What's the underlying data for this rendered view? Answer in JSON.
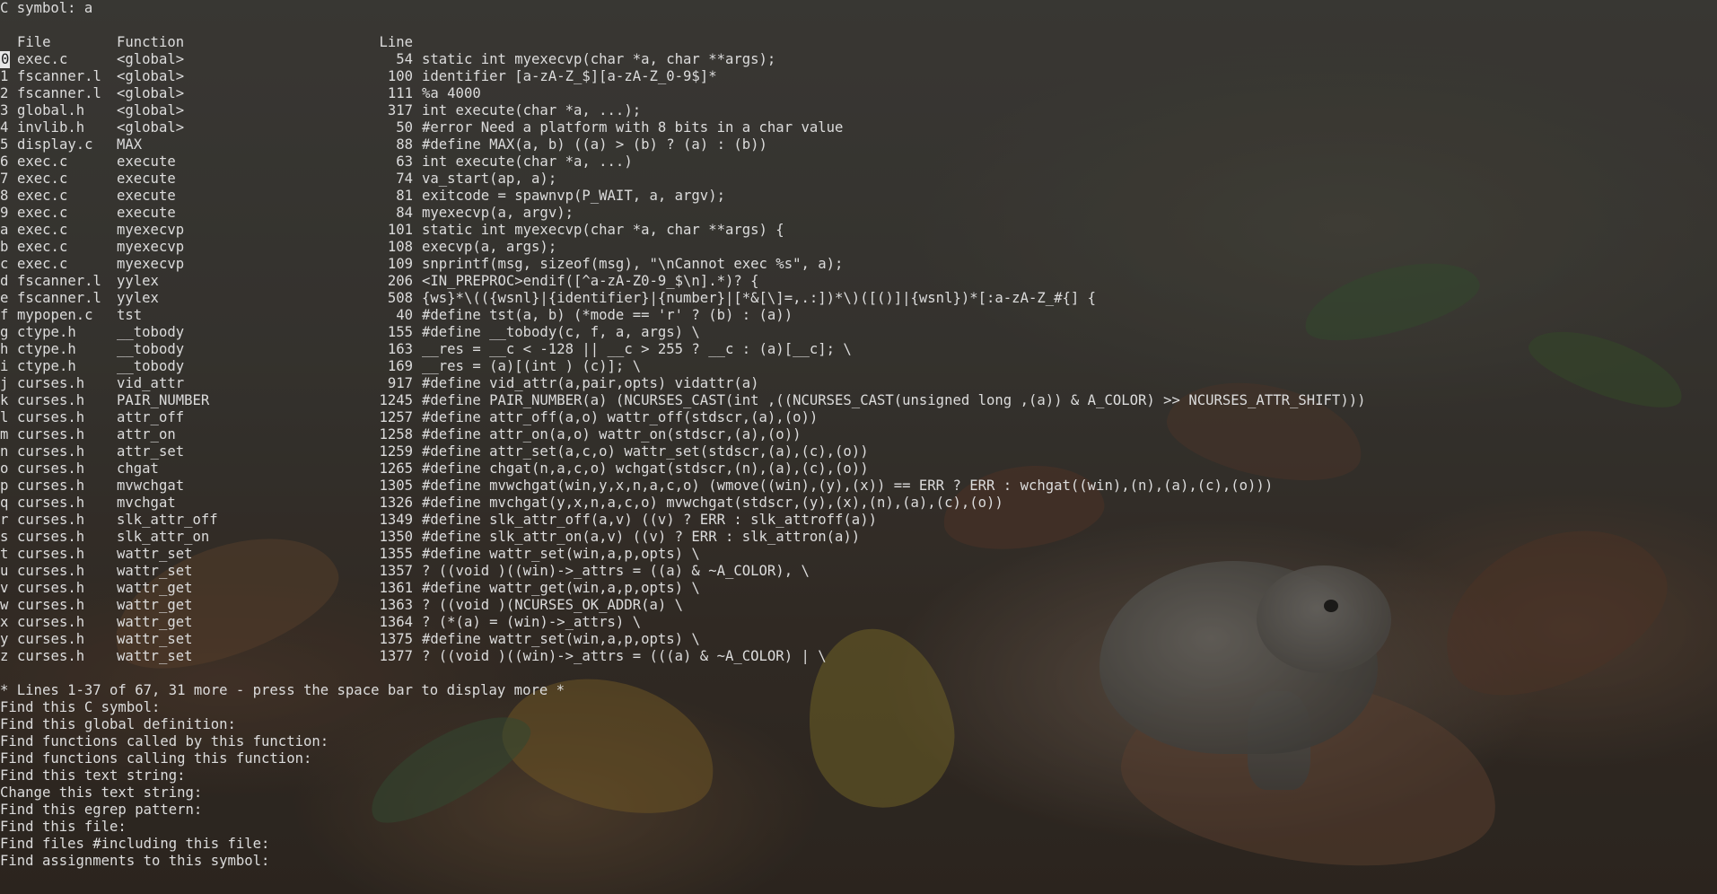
{
  "header": {
    "title": "C symbol: a"
  },
  "columns": {
    "file": "File",
    "function": "Function",
    "line": "Line"
  },
  "results": [
    {
      "key": "0",
      "file": "exec.c",
      "function": "<global>",
      "line": "54",
      "text": "static int myexecvp(char *a, char **args);"
    },
    {
      "key": "1",
      "file": "fscanner.l",
      "function": "<global>",
      "line": "100",
      "text": "identifier [a-zA-Z_$][a-zA-Z_0-9$]*"
    },
    {
      "key": "2",
      "file": "fscanner.l",
      "function": "<global>",
      "line": "111",
      "text": "%a 4000"
    },
    {
      "key": "3",
      "file": "global.h",
      "function": "<global>",
      "line": "317",
      "text": "int execute(char *a, ...);"
    },
    {
      "key": "4",
      "file": "invlib.h",
      "function": "<global>",
      "line": "50",
      "text": "#error Need a platform with 8 bits in a char value"
    },
    {
      "key": "5",
      "file": "display.c",
      "function": "MAX",
      "line": "88",
      "text": "#define MAX(a, b) ((a) > (b) ? (a) : (b))"
    },
    {
      "key": "6",
      "file": "exec.c",
      "function": "execute",
      "line": "63",
      "text": "int execute(char *a, ...)"
    },
    {
      "key": "7",
      "file": "exec.c",
      "function": "execute",
      "line": "74",
      "text": "va_start(ap, a);"
    },
    {
      "key": "8",
      "file": "exec.c",
      "function": "execute",
      "line": "81",
      "text": "exitcode = spawnvp(P_WAIT, a, argv);"
    },
    {
      "key": "9",
      "file": "exec.c",
      "function": "execute",
      "line": "84",
      "text": "myexecvp(a, argv);"
    },
    {
      "key": "a",
      "file": "exec.c",
      "function": "myexecvp",
      "line": "101",
      "text": "static int myexecvp(char *a, char **args) {"
    },
    {
      "key": "b",
      "file": "exec.c",
      "function": "myexecvp",
      "line": "108",
      "text": "execvp(a, args);"
    },
    {
      "key": "c",
      "file": "exec.c",
      "function": "myexecvp",
      "line": "109",
      "text": "snprintf(msg, sizeof(msg), \"\\nCannot exec %s\", a);"
    },
    {
      "key": "d",
      "file": "fscanner.l",
      "function": "yylex",
      "line": "206",
      "text": "<IN_PREPROC>endif([^a-zA-Z0-9_$\\n].*)? {"
    },
    {
      "key": "e",
      "file": "fscanner.l",
      "function": "yylex",
      "line": "508",
      "text": "{ws}*\\(({wsnl}|{identifier}|{number}|[*&[\\]=,.:])*\\)([()]|{wsnl})*[:a-zA-Z_#{] {"
    },
    {
      "key": "f",
      "file": "mypopen.c",
      "function": "tst",
      "line": "40",
      "text": "#define tst(a, b) (*mode == 'r' ? (b) : (a))"
    },
    {
      "key": "g",
      "file": "ctype.h",
      "function": "__tobody",
      "line": "155",
      "text": "#define __tobody(c, f, a, args) \\"
    },
    {
      "key": "h",
      "file": "ctype.h",
      "function": "__tobody",
      "line": "163",
      "text": "__res = __c < -128 || __c > 255 ? __c : (a)[__c]; \\"
    },
    {
      "key": "i",
      "file": "ctype.h",
      "function": "__tobody",
      "line": "169",
      "text": "__res = (a)[(int ) (c)]; \\"
    },
    {
      "key": "j",
      "file": "curses.h",
      "function": "vid_attr",
      "line": "917",
      "text": "#define vid_attr(a,pair,opts) vidattr(a)"
    },
    {
      "key": "k",
      "file": "curses.h",
      "function": "PAIR_NUMBER",
      "line": "1245",
      "text": "#define PAIR_NUMBER(a) (NCURSES_CAST(int ,((NCURSES_CAST(unsigned long ,(a)) & A_COLOR) >> NCURSES_ATTR_SHIFT)))"
    },
    {
      "key": "l",
      "file": "curses.h",
      "function": "attr_off",
      "line": "1257",
      "text": "#define attr_off(a,o) wattr_off(stdscr,(a),(o))"
    },
    {
      "key": "m",
      "file": "curses.h",
      "function": "attr_on",
      "line": "1258",
      "text": "#define attr_on(a,o) wattr_on(stdscr,(a),(o))"
    },
    {
      "key": "n",
      "file": "curses.h",
      "function": "attr_set",
      "line": "1259",
      "text": "#define attr_set(a,c,o) wattr_set(stdscr,(a),(c),(o))"
    },
    {
      "key": "o",
      "file": "curses.h",
      "function": "chgat",
      "line": "1265",
      "text": "#define chgat(n,a,c,o) wchgat(stdscr,(n),(a),(c),(o))"
    },
    {
      "key": "p",
      "file": "curses.h",
      "function": "mvwchgat",
      "line": "1305",
      "text": "#define mvwchgat(win,y,x,n,a,c,o) (wmove((win),(y),(x)) == ERR ? ERR : wchgat((win),(n),(a),(c),(o)))"
    },
    {
      "key": "q",
      "file": "curses.h",
      "function": "mvchgat",
      "line": "1326",
      "text": "#define mvchgat(y,x,n,a,c,o) mvwchgat(stdscr,(y),(x),(n),(a),(c),(o))"
    },
    {
      "key": "r",
      "file": "curses.h",
      "function": "slk_attr_off",
      "line": "1349",
      "text": "#define slk_attr_off(a,v) ((v) ? ERR : slk_attroff(a))"
    },
    {
      "key": "s",
      "file": "curses.h",
      "function": "slk_attr_on",
      "line": "1350",
      "text": "#define slk_attr_on(a,v) ((v) ? ERR : slk_attron(a))"
    },
    {
      "key": "t",
      "file": "curses.h",
      "function": "wattr_set",
      "line": "1355",
      "text": "#define wattr_set(win,a,p,opts) \\"
    },
    {
      "key": "u",
      "file": "curses.h",
      "function": "wattr_set",
      "line": "1357",
      "text": "? ((void )((win)->_attrs = ((a) & ~A_COLOR), \\"
    },
    {
      "key": "v",
      "file": "curses.h",
      "function": "wattr_get",
      "line": "1361",
      "text": "#define wattr_get(win,a,p,opts) \\"
    },
    {
      "key": "w",
      "file": "curses.h",
      "function": "wattr_get",
      "line": "1363",
      "text": "? ((void )(NCURSES_OK_ADDR(a) \\"
    },
    {
      "key": "x",
      "file": "curses.h",
      "function": "wattr_get",
      "line": "1364",
      "text": "? (*(a) = (win)->_attrs) \\"
    },
    {
      "key": "y",
      "file": "curses.h",
      "function": "wattr_set",
      "line": "1375",
      "text": "#define wattr_set(win,a,p,opts) \\"
    },
    {
      "key": "z",
      "file": "curses.h",
      "function": "wattr_set",
      "line": "1377",
      "text": "? ((void )((win)->_attrs = (((a) & ~A_COLOR) | \\"
    }
  ],
  "selected_key": "0",
  "status": "* Lines 1-37 of 67, 31 more - press the space bar to display more *",
  "prompts": [
    "Find this C symbol:",
    "Find this global definition:",
    "Find functions called by this function:",
    "Find functions calling this function:",
    "Find this text string:",
    "Change this text string:",
    "Find this egrep pattern:",
    "Find this file:",
    "Find files #including this file:",
    "Find assignments to this symbol:"
  ],
  "colors": {
    "text": "#dcdcdc",
    "selected_bg": "#e6e6e6"
  }
}
